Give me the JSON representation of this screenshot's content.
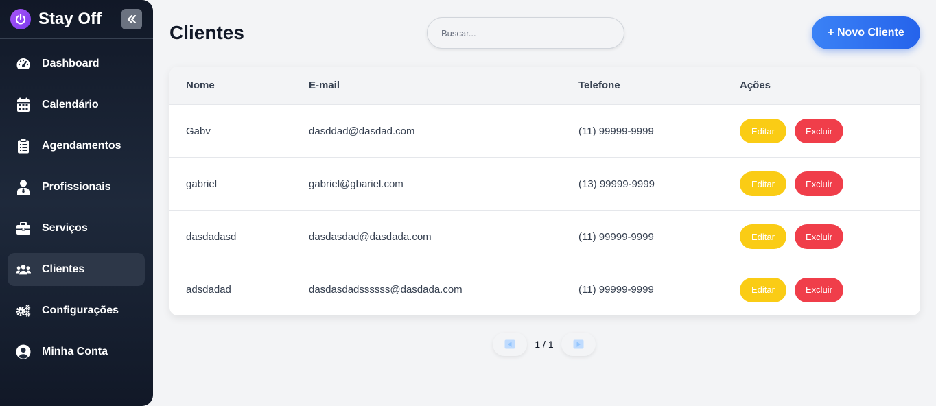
{
  "brand": {
    "name": "Stay Off",
    "accent": "#8b5cf6"
  },
  "sidebar": {
    "items": [
      {
        "label": "Dashboard",
        "icon": "gauge-icon",
        "active": false
      },
      {
        "label": "Calendário",
        "icon": "calendar-icon",
        "active": false
      },
      {
        "label": "Agendamentos",
        "icon": "clipboard-icon",
        "active": false
      },
      {
        "label": "Profissionais",
        "icon": "user-tie-icon",
        "active": false
      },
      {
        "label": "Serviços",
        "icon": "briefcase-icon",
        "active": false
      },
      {
        "label": "Clientes",
        "icon": "users-icon",
        "active": true
      },
      {
        "label": "Configurações",
        "icon": "gears-icon",
        "active": false
      },
      {
        "label": "Minha Conta",
        "icon": "user-circle-icon",
        "active": false
      }
    ]
  },
  "header": {
    "title": "Clientes",
    "search_placeholder": "Buscar...",
    "new_button": "+ Novo Cliente"
  },
  "table": {
    "columns": [
      "Nome",
      "E-mail",
      "Telefone",
      "Ações"
    ],
    "edit_label": "Editar",
    "delete_label": "Excluir",
    "rows": [
      {
        "nome": "Gabv",
        "email": "dasddad@dasdad.com",
        "telefone": "(11) 99999-9999"
      },
      {
        "nome": "gabriel",
        "email": "gabriel@gbariel.com",
        "telefone": "(13) 99999-9999"
      },
      {
        "nome": "dasdadasd",
        "email": "dasdasdad@dasdada.com",
        "telefone": "(11) 99999-9999"
      },
      {
        "nome": "adsdadad",
        "email": "dasdasdadssssss@dasdada.com",
        "telefone": "(11) 99999-9999"
      }
    ]
  },
  "pagination": {
    "text": "1 / 1"
  },
  "colors": {
    "primary": "#2563eb",
    "edit": "#facc15",
    "delete": "#f03e4a"
  }
}
